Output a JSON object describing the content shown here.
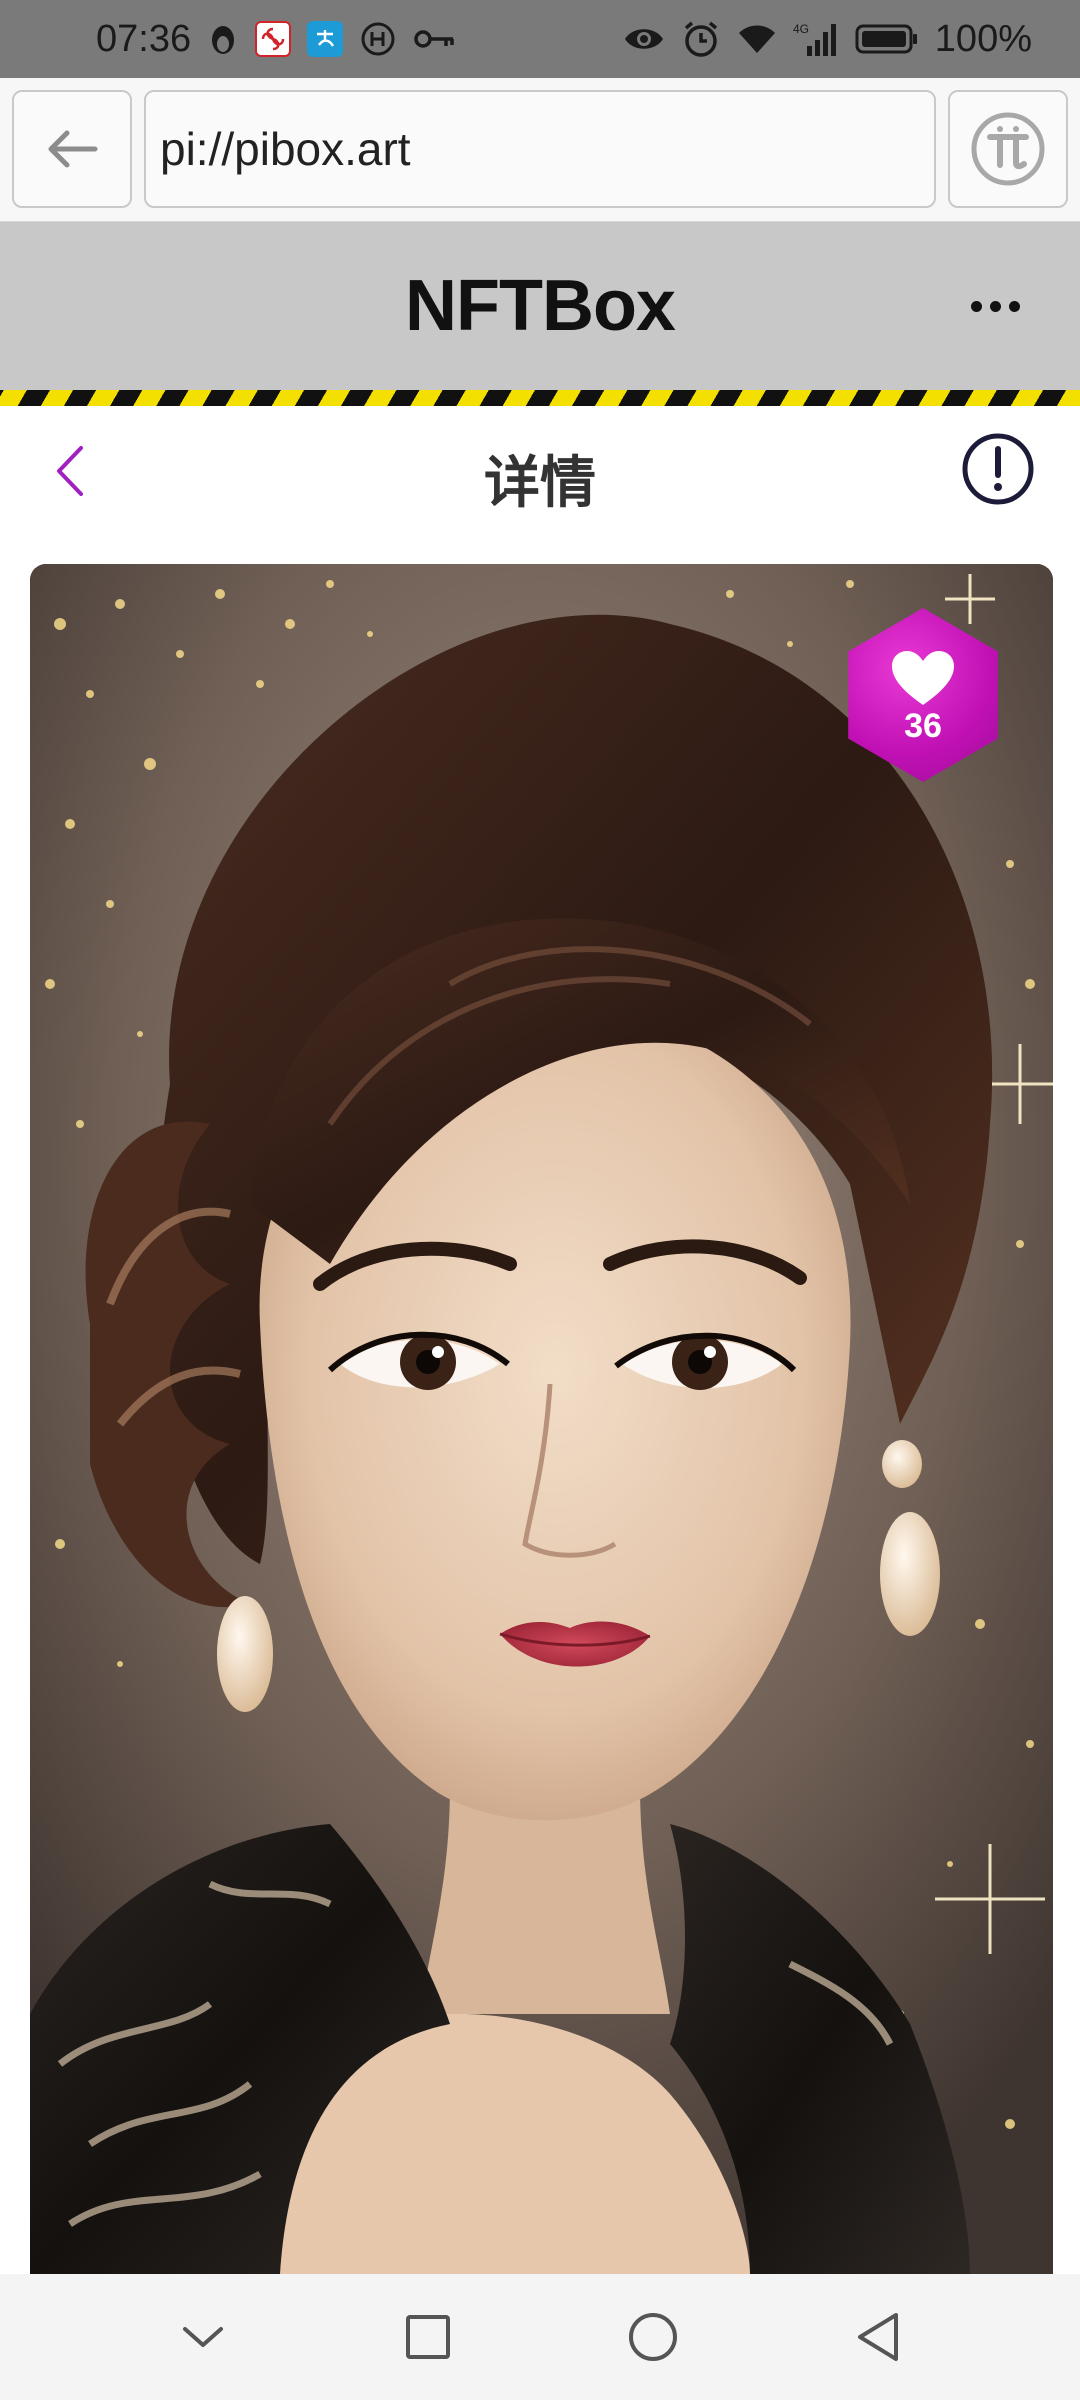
{
  "status_bar": {
    "time": "07:36",
    "network": "4G",
    "battery": "100%"
  },
  "browser": {
    "url": "pi://pibox.art"
  },
  "app": {
    "title": "NFTBox"
  },
  "page": {
    "title": "详情"
  },
  "artwork": {
    "likes": "36"
  },
  "colors": {
    "accent": "#c110b4",
    "header_bg": "#c8c8c8",
    "hazard_yellow": "#f3e000",
    "back_chevron": "#a020c0"
  },
  "icons": {
    "status_left": [
      "qq-penguin-icon",
      "china-unicom-icon",
      "alipay-icon",
      "vpn-icon",
      "key-icon"
    ],
    "status_right": [
      "eye-icon",
      "alarm-icon",
      "wifi-icon",
      "signal-icon",
      "battery-icon"
    ],
    "nav": [
      "chevron-down-icon",
      "square-icon",
      "circle-icon",
      "triangle-back-icon"
    ]
  }
}
